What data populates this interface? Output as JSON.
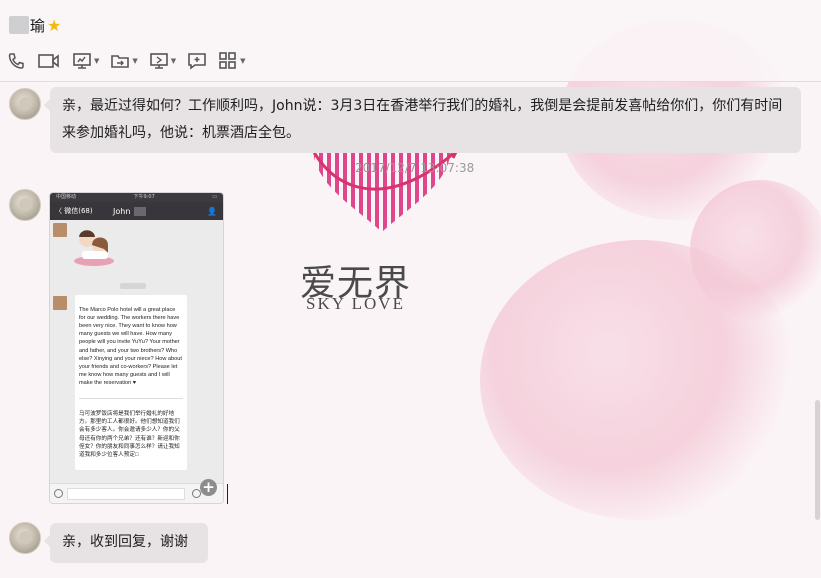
{
  "header": {
    "contact_name": "瑜",
    "toolbar": [
      {
        "name": "phone-call-icon",
        "dropdown": false
      },
      {
        "name": "video-call-icon",
        "dropdown": false
      },
      {
        "name": "screen-share-icon",
        "dropdown": true
      },
      {
        "name": "file-transfer-icon",
        "dropdown": true
      },
      {
        "name": "remote-desktop-icon",
        "dropdown": true
      },
      {
        "name": "message-icon",
        "dropdown": false
      },
      {
        "name": "apps-grid-icon",
        "dropdown": true
      }
    ]
  },
  "messages": [
    {
      "type": "text",
      "text": "亲，最近过得如何？工作顺利吗，John说：3月3日在香港举行我们的婚礼，我倒是会提前发喜帖给你们，你们有时间来参加婚礼吗，他说：机票酒店全包。"
    },
    {
      "type": "timestamp",
      "text": "2017/12/7 13:07:38"
    },
    {
      "type": "image",
      "description": "phone-chat-screenshot"
    },
    {
      "type": "text",
      "text": "亲，收到回复，谢谢"
    }
  ],
  "phone_screenshot": {
    "status_left": "中国移动",
    "status_center": "下午9:07",
    "back_label": "〈 微信(68)",
    "chat_title": "John",
    "english_message": "The Marco Polo hotel will a great place for our wedding. The workers there have been very nice. They want to know how many guests we will have. How many people will you invite YuYu? Your mother and father, and your two brothers? Who else? Xinying and your niece? How about your friends and co-workers? Please let me know how many guests and I will make the reservation ♥",
    "chinese_message": "马可波罗饭店将是我们举行婚礼的好地方。那里的工人都很好。他们想知道我们会有多少客人。你会邀请多少人？你的父母还有你的两个兄弟？还有谁？新迎和你侄女？你的朋友和同事怎么样？请让我知道我和多少位客人预定□"
  },
  "watermark": {
    "chinese": "爱无界",
    "english": "SKY LOVE"
  },
  "colors": {
    "bubble": "#e7e2e4",
    "star": "#f2b90f",
    "heart": "#e0468c"
  }
}
